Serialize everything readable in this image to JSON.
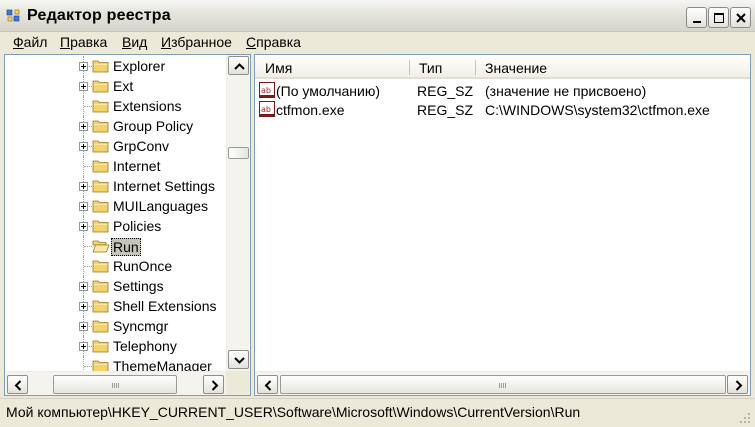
{
  "window": {
    "title": "Редактор реестра",
    "icon": "registry-editor-icon"
  },
  "menu": [
    "Файл",
    "Правка",
    "Вид",
    "Избранное",
    "Справка"
  ],
  "tree": {
    "items": [
      {
        "label": "Explorer",
        "expandable": true
      },
      {
        "label": "Ext",
        "expandable": true
      },
      {
        "label": "Extensions",
        "expandable": false
      },
      {
        "label": "Group Policy",
        "expandable": true
      },
      {
        "label": "GrpConv",
        "expandable": true
      },
      {
        "label": "Internet",
        "expandable": false
      },
      {
        "label": "Internet Settings",
        "expandable": true
      },
      {
        "label": "MUILanguages",
        "expandable": true
      },
      {
        "label": "Policies",
        "expandable": true
      },
      {
        "label": "Run",
        "expandable": false,
        "selected": true
      },
      {
        "label": "RunOnce",
        "expandable": false
      },
      {
        "label": "Settings",
        "expandable": true
      },
      {
        "label": "Shell Extensions",
        "expandable": true
      },
      {
        "label": "Syncmgr",
        "expandable": true
      },
      {
        "label": "Telephony",
        "expandable": true
      },
      {
        "label": "ThemeManager",
        "expandable": false
      }
    ]
  },
  "list": {
    "columns": [
      "Имя",
      "Тип",
      "Значение"
    ],
    "rows": [
      {
        "name": "(По умолчанию)",
        "type": "REG_SZ",
        "value": "(значение не присвоено)",
        "icon": "string-value-icon"
      },
      {
        "name": "ctfmon.exe",
        "type": "REG_SZ",
        "value": "C:\\WINDOWS\\system32\\ctfmon.exe",
        "icon": "string-value-icon"
      }
    ]
  },
  "status": {
    "path": "Мой компьютер\\HKEY_CURRENT_USER\\Software\\Microsoft\\Windows\\CurrentVersion\\Run"
  },
  "colors": {
    "border": "#7f9db9",
    "chrome": "#ece9d8",
    "folder": "#f5d36b",
    "selection": "#c6c3b9"
  }
}
